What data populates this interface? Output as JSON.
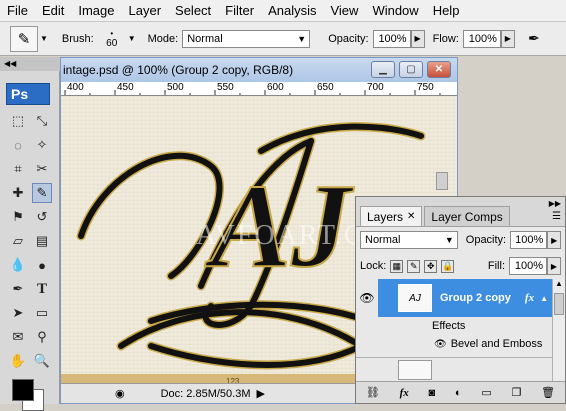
{
  "menubar": {
    "items": [
      "File",
      "Edit",
      "Image",
      "Layer",
      "Select",
      "Filter",
      "Analysis",
      "View",
      "Window",
      "Help"
    ]
  },
  "options_bar": {
    "brush_label": "Brush:",
    "brush_size": "60",
    "mode_label": "Mode:",
    "mode_value": "Normal",
    "opacity_label": "Opacity:",
    "opacity_value": "100%",
    "flow_label": "Flow:",
    "flow_value": "100%"
  },
  "toolbox": {
    "logo": "Ps"
  },
  "document": {
    "title": "intage.psd @ 100% (Group 2 copy, RGB/8)",
    "ruler_ticks": [
      "400",
      "450",
      "500",
      "550",
      "600",
      "650",
      "700",
      "750"
    ],
    "watermark": "AVFOART.COM",
    "monogram": "AJ",
    "status_doc": "Doc: 2.85M/50.3M",
    "canvas_marker": "123"
  },
  "layers_panel": {
    "tabs": [
      "Layers",
      "Layer Comps"
    ],
    "blend_mode": "Normal",
    "opacity_label": "Opacity:",
    "opacity_value": "100%",
    "lock_label": "Lock:",
    "fill_label": "Fill:",
    "fill_value": "100%",
    "layer_name": "Group 2 copy",
    "fx_label": "fx",
    "effects_label": "Effects",
    "effect_item": "Bevel and Emboss"
  },
  "colors": {
    "selected_layer": "#3d8ee0",
    "menu_bg": "#f0f0f0",
    "canvas_bg": "#efeadc",
    "foreground": "#000000",
    "background": "#ffffff"
  }
}
